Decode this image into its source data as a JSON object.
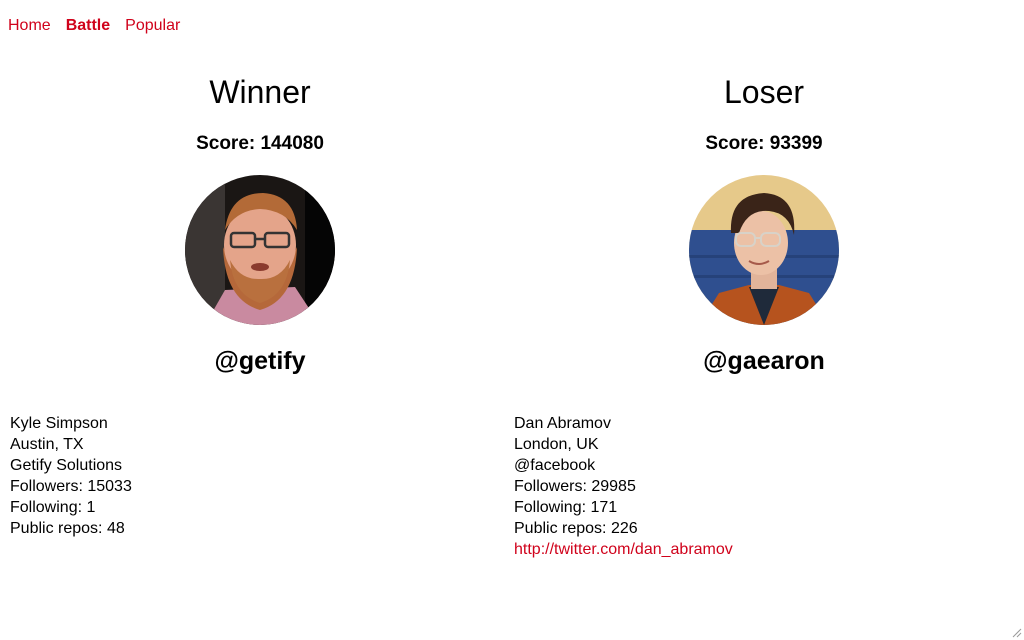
{
  "nav": {
    "items": [
      {
        "label": "Home",
        "active": false
      },
      {
        "label": "Battle",
        "active": true
      },
      {
        "label": "Popular",
        "active": false
      }
    ],
    "color": "#d0021b"
  },
  "players": [
    {
      "result": "Winner",
      "score_text": "Score: 144080",
      "username": "@getify",
      "avatar": "profile-photo-getify",
      "details": {
        "name": "Kyle Simpson",
        "location": "Austin, TX",
        "company": "Getify Solutions",
        "followers": "Followers: 15033",
        "following": "Following: 1",
        "repos": "Public repos: 48"
      }
    },
    {
      "result": "Loser",
      "score_text": "Score: 93399",
      "username": "@gaearon",
      "avatar": "profile-photo-gaearon",
      "details": {
        "name": "Dan Abramov",
        "location": "London, UK",
        "company": "@facebook",
        "followers": "Followers: 29985",
        "following": "Following: 171",
        "repos": "Public repos: 226",
        "blog": "http://twitter.com/dan_abramov"
      }
    }
  ]
}
